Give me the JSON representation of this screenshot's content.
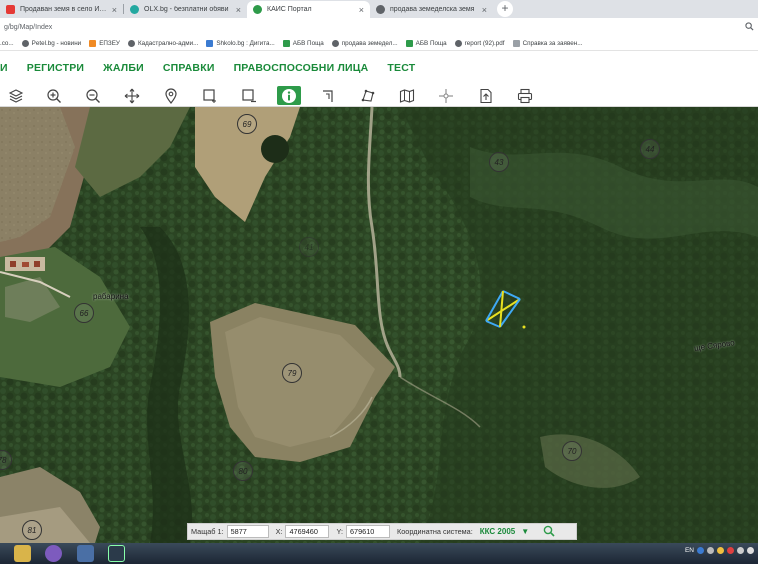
{
  "browser": {
    "tabs": [
      {
        "title": "Продаван земя в село Изгрев...",
        "favicon_color": "#e53935",
        "active": false
      },
      {
        "title": "OLX.bg - безплатни обяви",
        "favicon_color": "#23a8a0",
        "active": false
      },
      {
        "title": "КАИС Портал",
        "favicon_color": "#2e9b4a",
        "active": true
      },
      {
        "title": "продава земеделска земя",
        "favicon_color": "#5f6368",
        "active": false
      }
    ],
    "new_tab": "+",
    "close": "×",
    "url": "g/bg/Map/Index",
    "zoom_icon": "zoom-icon"
  },
  "bookmarks": [
    {
      "label": ".co...",
      "color": "#777"
    },
    {
      "label": "Petel.bg - новини",
      "color": "#5f6368"
    },
    {
      "label": "ЕПЗЕУ",
      "color": "#f08a24"
    },
    {
      "label": "Кадастрално-адми...",
      "color": "#5f6368"
    },
    {
      "label": "Shkolo.bg : Дигита...",
      "color": "#3b7bd1"
    },
    {
      "label": "АБВ Поща",
      "color": "#2e9b4a"
    },
    {
      "label": "продава земедел...",
      "color": "#5f6368"
    },
    {
      "label": "АБВ Поща",
      "color": "#2e9b4a"
    },
    {
      "label": "report (92).pdf",
      "color": "#5f6368"
    },
    {
      "label": "Справка за заявен...",
      "color": "#5f6368"
    }
  ],
  "nav": {
    "items": [
      "И",
      "РЕГИСТРИ",
      "ЖАЛБИ",
      "СПРАВКИ",
      "ПРАВОСПОСОБНИ ЛИЦА",
      "ТЕСТ"
    ]
  },
  "toolbar": {
    "tools": [
      "layers-icon",
      "zoom-in-icon",
      "zoom-out-icon",
      "pan-icon",
      "marker-icon",
      "select-area-icon",
      "clear-selection-icon",
      "info-icon",
      "measure-icon",
      "draw-polygon-icon",
      "map-icon",
      "crosshair-icon",
      "export-icon",
      "print-icon"
    ],
    "active": "info-icon"
  },
  "map": {
    "parcels": [
      "69",
      "43",
      "44",
      "41",
      "66",
      "79",
      "70",
      "78",
      "80",
      "81"
    ],
    "place_names": [
      "рабарина",
      "ще Сярово"
    ]
  },
  "coordinates": {
    "scale_label": "Мащаб 1:",
    "scale_value": "5877",
    "x_label": "X:",
    "x_value": "4769460",
    "y_label": "Y:",
    "y_value": "679610",
    "system_label": "Координатна система:",
    "system_value": "ККС 2005",
    "dropdown_icon": "▼"
  },
  "taskbar": {
    "language": "EN"
  },
  "colors": {
    "accent_green": "#1a8a3a",
    "active_tool": "#2e9b4a",
    "selection_blue": "#3fa9f5",
    "selection_yellow": "#e8e020"
  }
}
